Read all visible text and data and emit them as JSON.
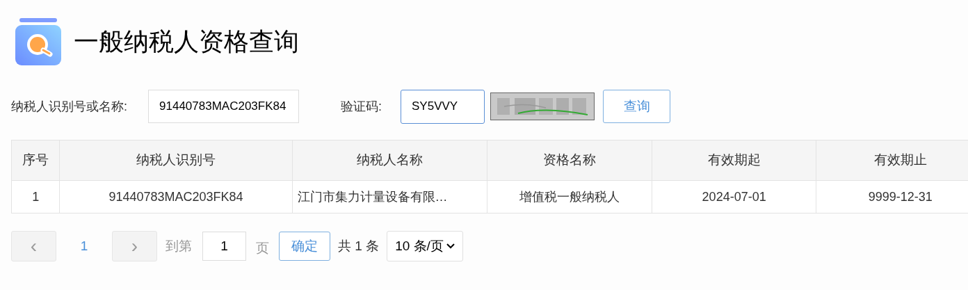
{
  "title": "一般纳税人资格查询",
  "form": {
    "id_label": "纳税人识别号或名称:",
    "id_value": "91440783MAC203FK84",
    "captcha_label": "验证码:",
    "captcha_value": "SY5VVY",
    "search_button": "查询"
  },
  "table": {
    "columns": [
      "序号",
      "纳税人识别号",
      "纳税人名称",
      "资格名称",
      "有效期起",
      "有效期止"
    ],
    "rows": [
      [
        "1",
        "91440783MAC203FK84",
        "江门市集力计量设备有限…",
        "增值税一般纳税人",
        "2024-07-01",
        "9999-12-31"
      ]
    ]
  },
  "pagination": {
    "prev": "‹",
    "pages": [
      {
        "label": "1",
        "selected": true
      }
    ],
    "next": "›",
    "goto_label": "到第",
    "goto_value": "1",
    "page_unit": "页",
    "confirm": "确定",
    "total": "共 1 条",
    "page_size": "10 条/页"
  }
}
